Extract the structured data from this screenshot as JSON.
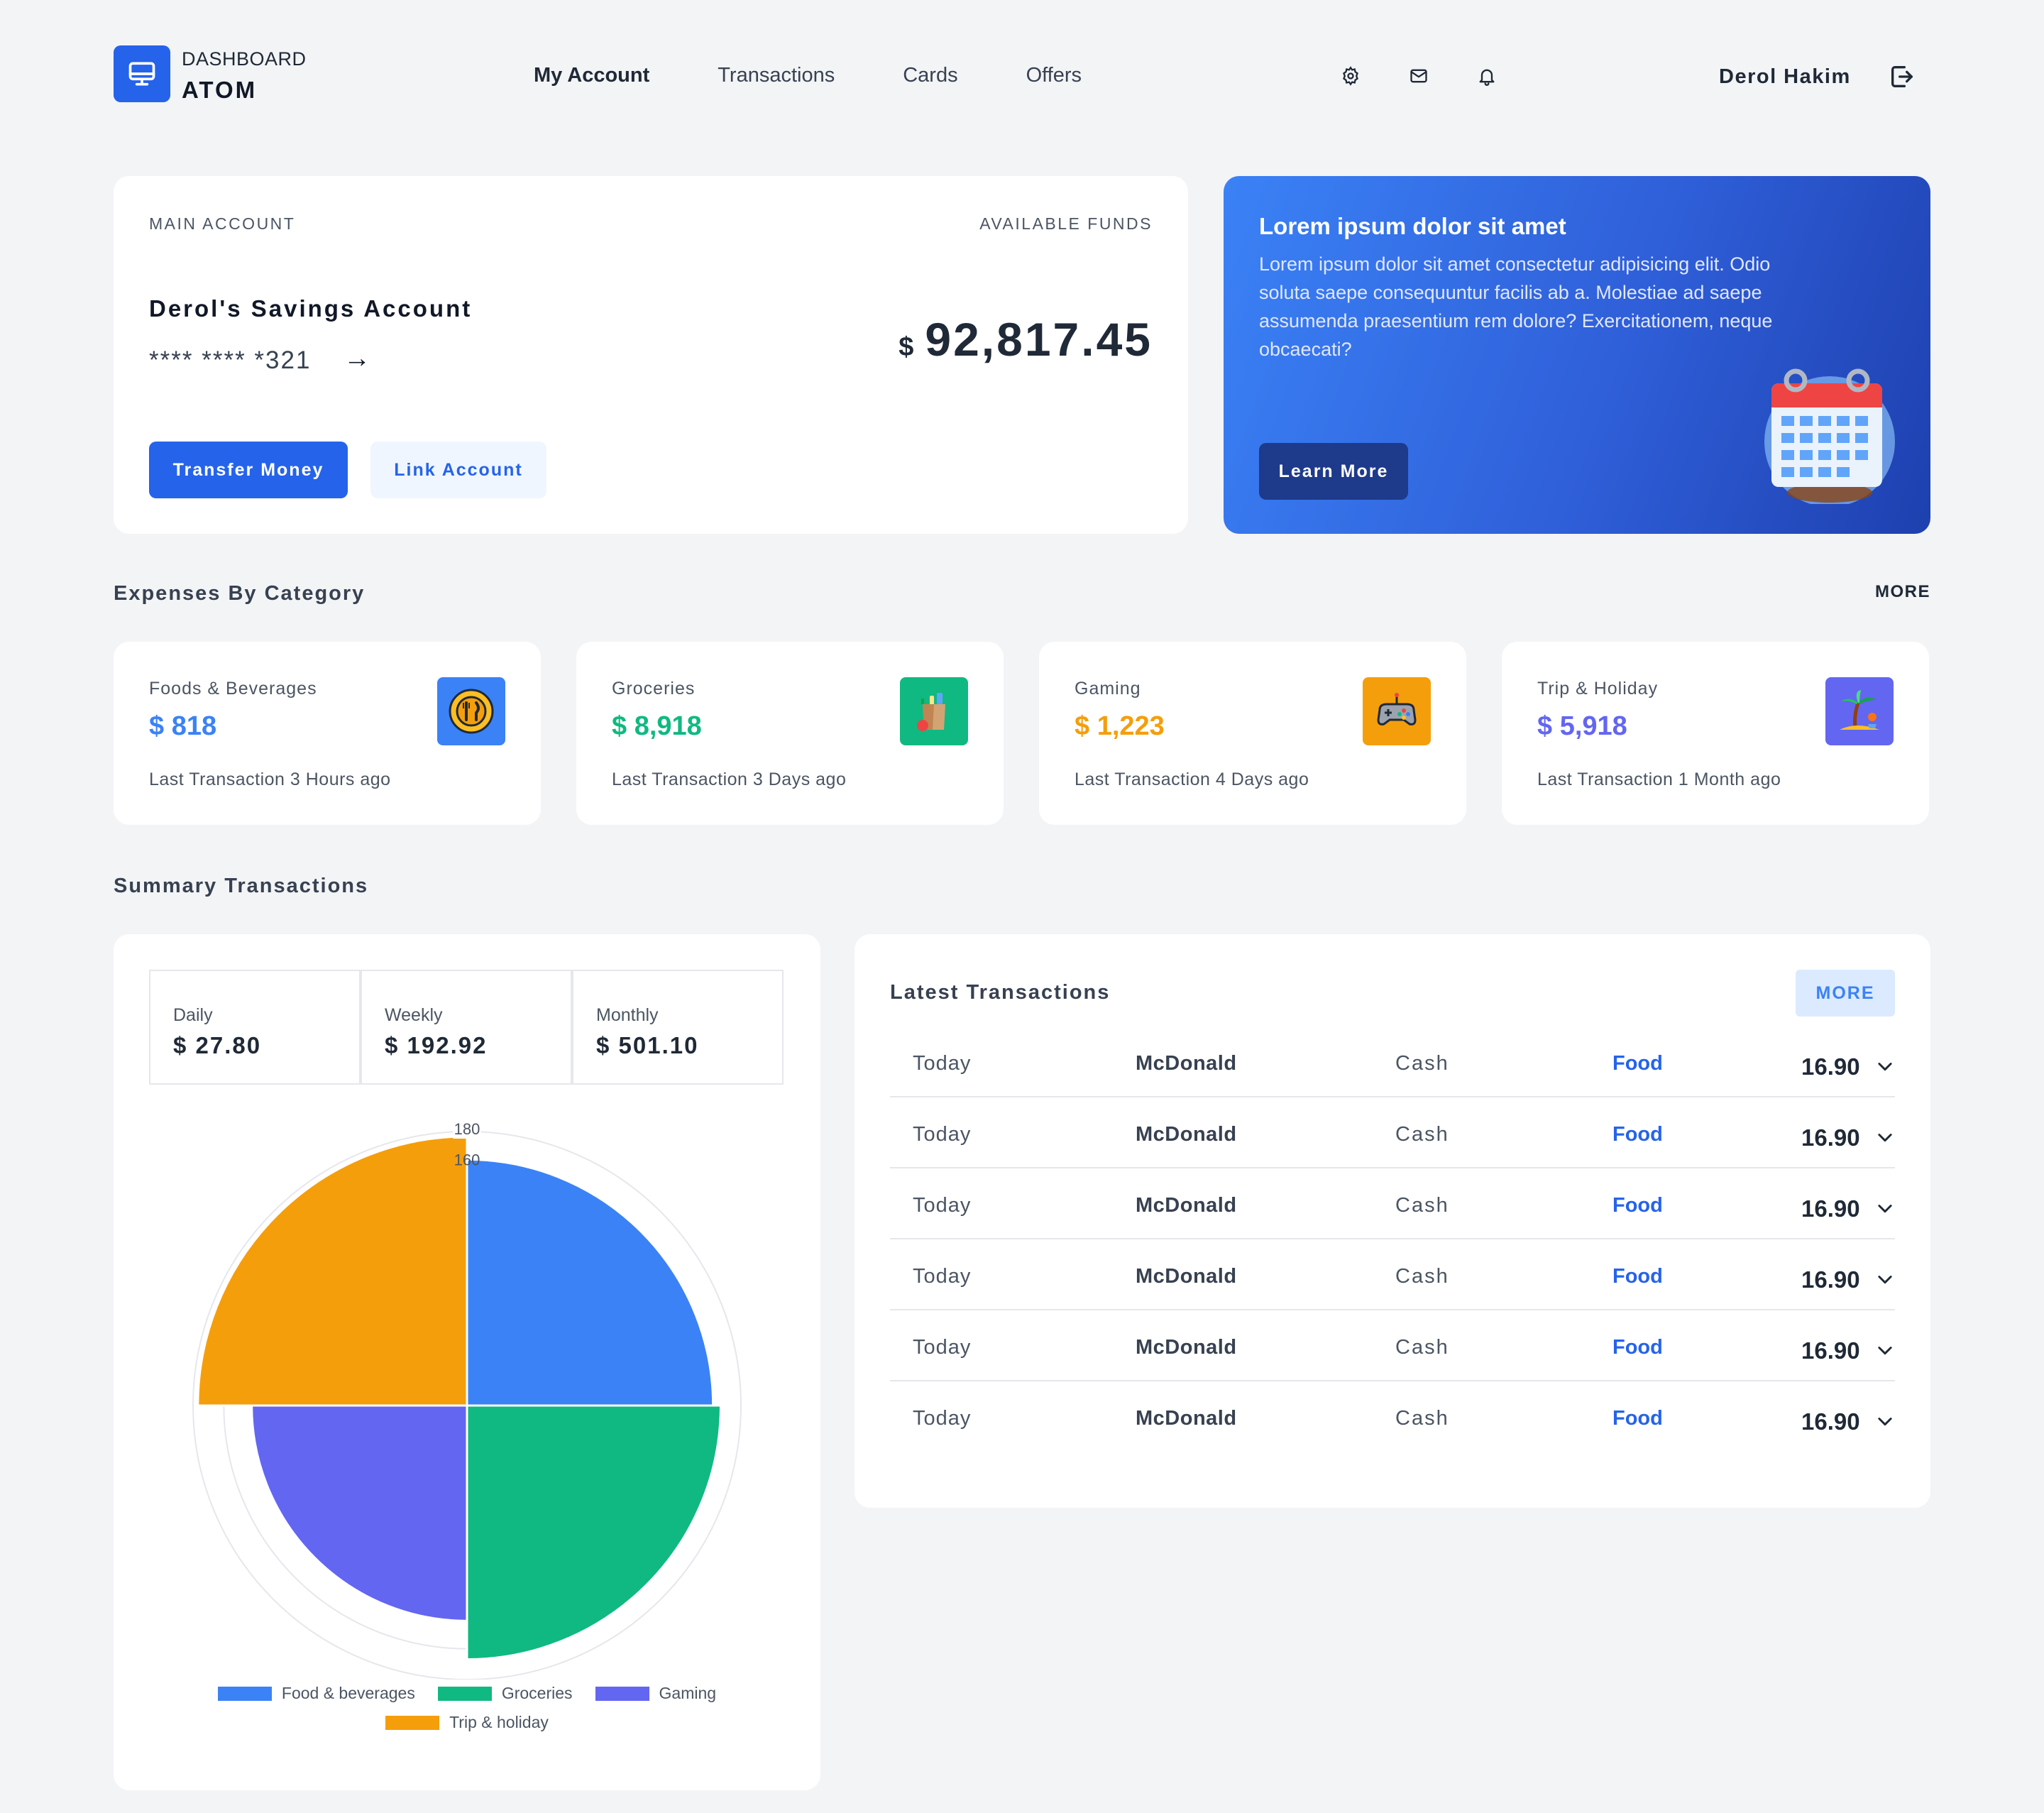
{
  "header": {
    "logo_top": "DASHBOARD",
    "logo_bottom": "ATOM",
    "nav": [
      "My Account",
      "Transactions",
      "Cards",
      "Offers"
    ],
    "user_name": "Derol Hakim"
  },
  "account": {
    "label": "MAIN ACCOUNT",
    "funds_label": "AVAILABLE FUNDS",
    "name": "Derol's Savings Account",
    "number": "**** **** *321",
    "arrow": "→",
    "currency": "$",
    "balance": "92,817.45",
    "transfer_button": "Transfer Money",
    "link_button": "Link Account"
  },
  "promo": {
    "title": "Lorem ipsum dolor sit amet",
    "text": "Lorem ipsum dolor sit amet consectetur adipisicing elit. Odio soluta saepe consequuntur facilis ab a. Molestiae ad saepe assumenda praesentium rem dolore? Exercitationem, neque obcaecati?",
    "button": "Learn More"
  },
  "expenses": {
    "title": "Expenses By Category",
    "more": "MORE",
    "items": [
      {
        "name": "Foods & Beverages",
        "amount": "$ 818",
        "last": "Last Transaction 3 Hours ago",
        "color": "#3b82f6",
        "icon": "food-icon"
      },
      {
        "name": "Groceries",
        "amount": "$ 8,918",
        "last": "Last Transaction 3 Days ago",
        "color": "#10b981",
        "icon": "groceries-icon"
      },
      {
        "name": "Gaming",
        "amount": "$ 1,223",
        "last": "Last Transaction 4 Days ago",
        "color": "#f59e0b",
        "icon": "gamepad-icon"
      },
      {
        "name": "Trip & Holiday",
        "amount": "$ 5,918",
        "last": "Last Transaction 1 Month ago",
        "color": "#6366f1",
        "icon": "palm-tree-icon"
      }
    ]
  },
  "summary": {
    "title": "Summary Transactions",
    "periods": [
      {
        "label": "Daily",
        "value": "$ 27.80"
      },
      {
        "label": "Weekly",
        "value": "$ 192.92"
      },
      {
        "label": "Monthly",
        "value": "$ 501.10"
      }
    ]
  },
  "chart_data": {
    "type": "polar-area",
    "categories": [
      "Food & beverages",
      "Groceries",
      "Gaming",
      "Trip & holiday"
    ],
    "values": [
      160,
      165,
      140,
      175
    ],
    "colors": [
      "#3b82f6",
      "#10b981",
      "#6366f1",
      "#f59e0b"
    ],
    "rlim": [
      0,
      180
    ],
    "tick_labels": [
      "180",
      "160"
    ],
    "legend_position": "bottom"
  },
  "latest": {
    "title": "Latest Transactions",
    "more": "MORE",
    "rows": [
      {
        "date": "Today",
        "merchant": "McDonald",
        "method": "Cash",
        "category": "Food",
        "amount": "16.90"
      },
      {
        "date": "Today",
        "merchant": "McDonald",
        "method": "Cash",
        "category": "Food",
        "amount": "16.90"
      },
      {
        "date": "Today",
        "merchant": "McDonald",
        "method": "Cash",
        "category": "Food",
        "amount": "16.90"
      },
      {
        "date": "Today",
        "merchant": "McDonald",
        "method": "Cash",
        "category": "Food",
        "amount": "16.90"
      },
      {
        "date": "Today",
        "merchant": "McDonald",
        "method": "Cash",
        "category": "Food",
        "amount": "16.90"
      },
      {
        "date": "Today",
        "merchant": "McDonald",
        "method": "Cash",
        "category": "Food",
        "amount": "16.90"
      }
    ]
  }
}
